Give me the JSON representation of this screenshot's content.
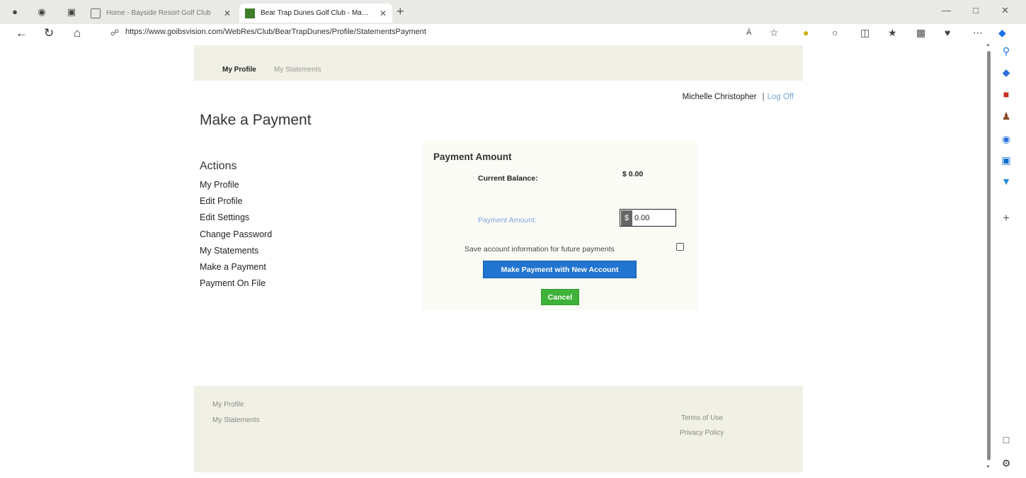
{
  "browser": {
    "tabs": [
      {
        "title": "Home - Bayside Resort Golf Club",
        "active": false
      },
      {
        "title": "Bear Trap Dunes Golf Club - Ma…",
        "active": true
      }
    ],
    "url": "https://www.goibsvision.com/WebRes/Club/BearTrapDunes/Profile/StatementsPayment",
    "read_aloud_label": "Á"
  },
  "topnav": {
    "items": [
      "My Profile",
      "My Statements"
    ]
  },
  "user": {
    "name": "Michelle Christopher",
    "separator": "|",
    "logoff_label": "Log Off"
  },
  "page": {
    "title": "Make a Payment"
  },
  "actions": {
    "heading": "Actions",
    "items": [
      "My Profile",
      "Edit Profile",
      "Edit Settings",
      "Change Password",
      "My Statements",
      "Make a Payment",
      "Payment On File"
    ]
  },
  "payment": {
    "heading": "Payment Amount",
    "balance_label": "Current Balance:",
    "balance_value": "$ 0.00",
    "amount_label": "Payment Amount:",
    "currency_symbol": "$",
    "amount_value": "0.00",
    "save_label": "Save account information for future payments",
    "pay_button": "Make Payment with New Account",
    "cancel_button": "Cancel"
  },
  "footer": {
    "left_links": [
      "My Profile",
      "My Statements"
    ],
    "right_links": [
      "Terms of Use",
      "Privacy Policy"
    ]
  },
  "colors": {
    "pay_button": "#2174cf",
    "cancel_button": "#3fb23a",
    "link_blue": "#7aa6d6",
    "nav_bg": "#f1f0e4"
  }
}
